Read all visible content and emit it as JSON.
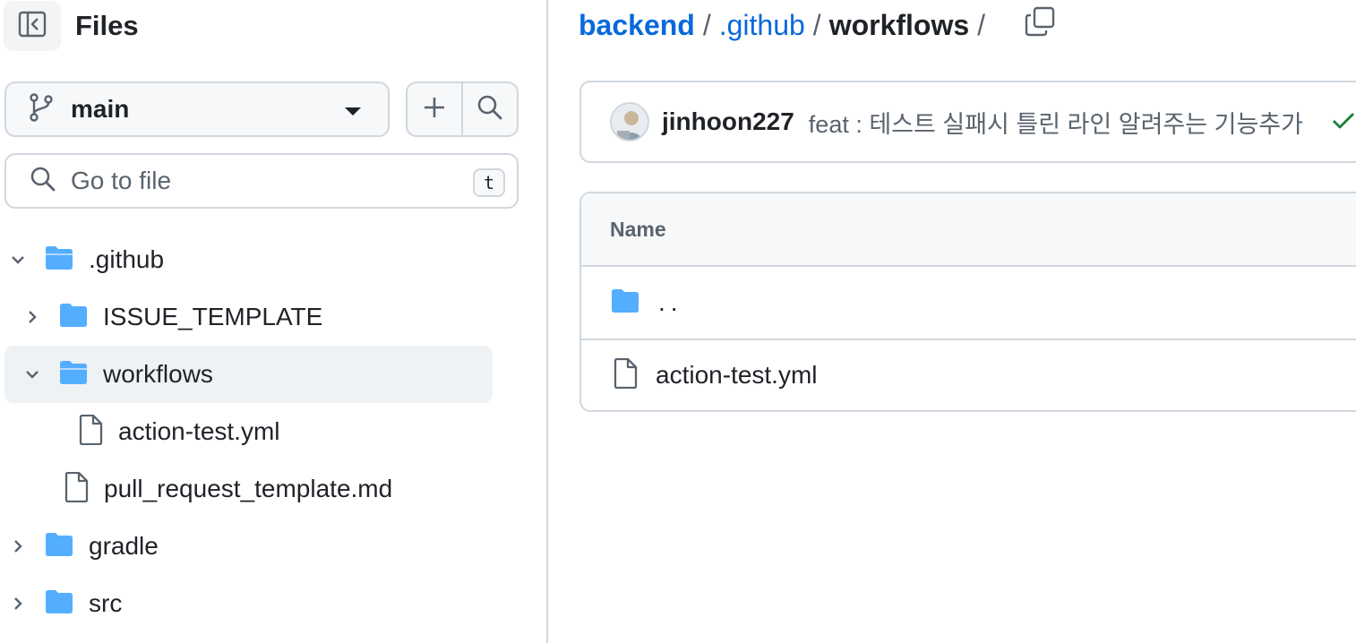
{
  "sidebar": {
    "title": "Files",
    "branch": "main",
    "search": {
      "placeholder": "Go to file",
      "shortcut": "t"
    },
    "tree": [
      {
        "label": ".github",
        "kind": "folder",
        "expanded": true,
        "depth": 0
      },
      {
        "label": "ISSUE_TEMPLATE",
        "kind": "folder",
        "expanded": false,
        "depth": 1
      },
      {
        "label": "workflows",
        "kind": "folder",
        "expanded": true,
        "depth": 1,
        "active": true
      },
      {
        "label": "action-test.yml",
        "kind": "file",
        "depth": 2
      },
      {
        "label": "pull_request_template.md",
        "kind": "file",
        "depth": 1
      },
      {
        "label": "gradle",
        "kind": "folder",
        "expanded": false,
        "depth": 0
      },
      {
        "label": "src",
        "kind": "folder",
        "expanded": false,
        "depth": 0
      }
    ]
  },
  "breadcrumb": {
    "items": [
      "backend",
      ".github",
      "workflows"
    ],
    "separator": "/"
  },
  "commit": {
    "author": "jinhoon227",
    "message": "feat : 테스트 실패시 틀린 라인 알려주는 기능추가",
    "status": "success"
  },
  "table": {
    "header": "Name",
    "rows": [
      {
        "name": "..",
        "kind": "parent-folder"
      },
      {
        "name": "action-test.yml",
        "kind": "file"
      }
    ]
  },
  "colors": {
    "link": "#0969da",
    "folder": "#54aeff",
    "border": "#d0d7de",
    "muted": "#59636e",
    "success": "#1a7f37"
  },
  "icons": [
    "sidebar-collapse-icon",
    "git-branch-icon",
    "plus-icon",
    "search-icon",
    "chevron-down-icon",
    "chevron-right-icon",
    "folder-icon",
    "folder-open-icon",
    "file-icon",
    "copy-icon",
    "check-icon"
  ]
}
